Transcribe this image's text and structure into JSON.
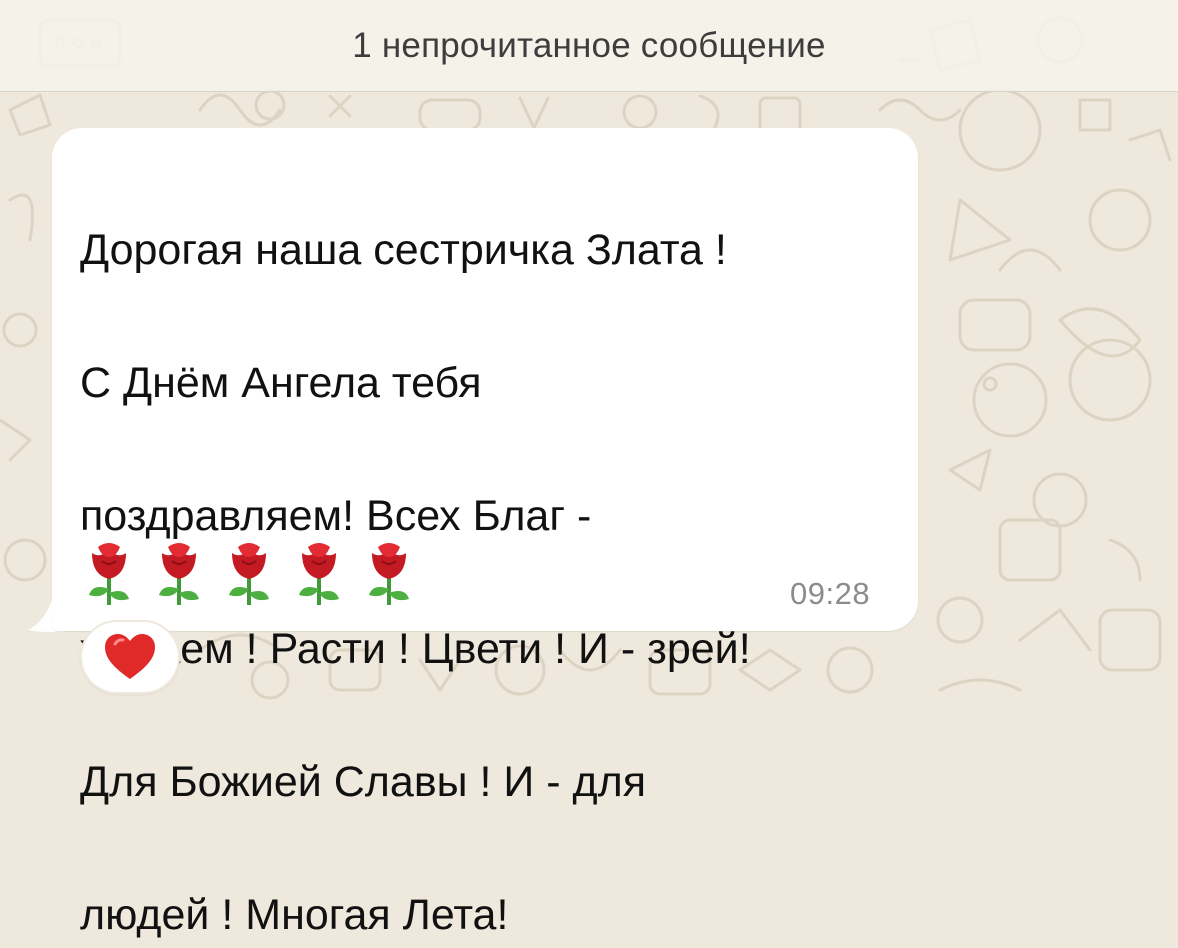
{
  "banner": {
    "unread_label": "1 непрочитанное сообщение"
  },
  "message": {
    "lines": [
      "Дорогая наша сестричка Злата !",
      "С Днём Ангела тебя",
      "поздравляем! Всех Благ -",
      "желаем ! Расти ! Цвети ! И - зрей!",
      "Для Божией Славы ! И - для",
      "людей ! Многая Лета!"
    ],
    "emoji": [
      "rose-icon",
      "rose-icon",
      "rose-icon",
      "rose-icon",
      "rose-icon"
    ],
    "time": "09:28"
  },
  "reaction": {
    "icon": "red-heart-icon"
  },
  "colors": {
    "chat_background": "#efe8dc",
    "bubble": "#ffffff",
    "timestamp": "#8c8c8c",
    "rose": "#d3202a",
    "heart": "#e02a2a"
  }
}
